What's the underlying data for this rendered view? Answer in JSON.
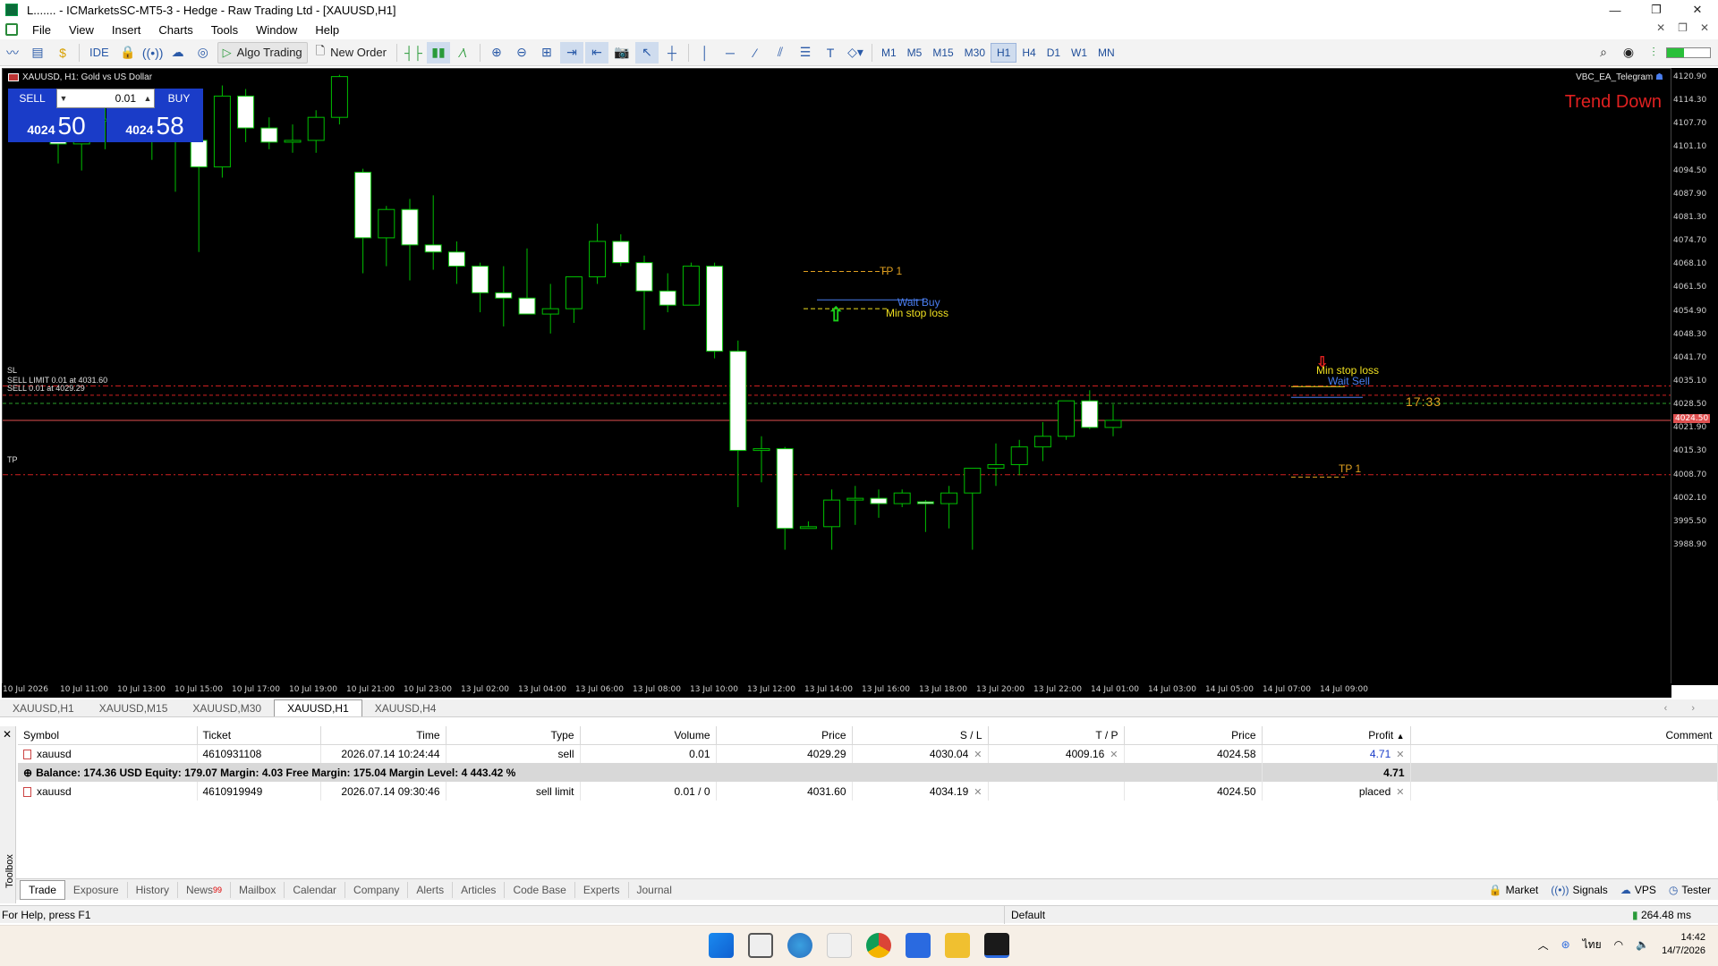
{
  "window": {
    "title": "ICMarketsSC-MT5-3 - Hedge - Raw Trading Ltd - [XAUUSD,H1]",
    "title_prefix": "L.......",
    "controls": [
      "—",
      "❐",
      "✕"
    ]
  },
  "menu": [
    "File",
    "View",
    "Insert",
    "Charts",
    "Tools",
    "Window",
    "Help"
  ],
  "toolbar": {
    "ide_label": "IDE",
    "algo_trading_label": "Algo Trading",
    "new_order_label": "New Order",
    "timeframes": [
      "M1",
      "M5",
      "M15",
      "M30",
      "H1",
      "H4",
      "D1",
      "W1",
      "MN"
    ],
    "active_timeframe": "H1"
  },
  "chart": {
    "symbol_label": "XAUUSD, H1:  Gold vs US Dollar",
    "ea_label": "VBC_EA_Telegram",
    "trend_text": "Trend Down",
    "countdown": "17:33",
    "one_click": {
      "sell_label": "SELL",
      "buy_label": "BUY",
      "lot": "0.01",
      "sell_price_small": "4024",
      "sell_price_big": "50",
      "buy_price_small": "4024",
      "buy_price_big": "58"
    },
    "line_labels": {
      "sl": "SL",
      "sell_limit": "SELL LIMIT 0.01 at 4031.60",
      "sell": "SELL 0.01 at 4029.29",
      "tp": "TP"
    },
    "annotations": {
      "tp1_upper": "TP 1",
      "wait_buy": "Wait Buy",
      "min_sl_upper": "Min stop loss",
      "min_sl_lower": "Min stop loss",
      "wait_sell": "Wait Sell",
      "tp1_lower": "TP 1"
    },
    "price_ticks": [
      "4120.90",
      "4114.30",
      "4107.70",
      "4101.10",
      "4094.50",
      "4087.90",
      "4081.30",
      "4074.70",
      "4068.10",
      "4061.50",
      "4054.90",
      "4048.30",
      "4041.70",
      "4035.10",
      "4028.50",
      "4021.90",
      "4015.30",
      "4008.70",
      "4002.10",
      "3995.50",
      "3988.90"
    ],
    "current_price_tag": "4024.50",
    "time_ticks": [
      "10 Jul 2026",
      "10 Jul 11:00",
      "10 Jul 13:00",
      "10 Jul 15:00",
      "10 Jul 17:00",
      "10 Jul 19:00",
      "10 Jul 21:00",
      "10 Jul 23:00",
      "13 Jul 02:00",
      "13 Jul 04:00",
      "13 Jul 06:00",
      "13 Jul 08:00",
      "13 Jul 10:00",
      "13 Jul 12:00",
      "13 Jul 14:00",
      "13 Jul 16:00",
      "13 Jul 18:00",
      "13 Jul 20:00",
      "13 Jul 22:00",
      "14 Jul 01:00",
      "14 Jul 03:00",
      "14 Jul 05:00",
      "14 Jul 07:00",
      "14 Jul 09:00"
    ],
    "colors": {
      "bg": "#000000",
      "candle": "#ffffff",
      "wick": "#00c000",
      "sl_line": "#d02020",
      "tp_line": "#d02020",
      "bid_line": "#e05050",
      "wait_buy": "#4a7ef0",
      "tp1": "#e0a020",
      "min_sl": "#f0e020",
      "trend": "#e02020",
      "countdown": "#e0a020"
    },
    "candles": [
      {
        "o": 4111.0,
        "h": 4117.0,
        "l": 4097.0,
        "c": 4102.5
      },
      {
        "o": 4102.5,
        "h": 4109.5,
        "l": 4095.0,
        "c": 4109.0
      },
      {
        "o": 4109.0,
        "h": 4114.0,
        "l": 4101.0,
        "c": 4109.5
      },
      {
        "o": 4109.5,
        "h": 4113.0,
        "l": 4104.0,
        "c": 4106.5
      },
      {
        "o": 4106.5,
        "h": 4111.0,
        "l": 4098.0,
        "c": 4104.5
      },
      {
        "o": 4104.5,
        "h": 4109.0,
        "l": 4089.0,
        "c": 4103.5
      },
      {
        "o": 4103.5,
        "h": 4112.0,
        "l": 4072.0,
        "c": 4096.0
      },
      {
        "o": 4096.0,
        "h": 4119.0,
        "l": 4093.0,
        "c": 4116.0
      },
      {
        "o": 4116.0,
        "h": 4118.0,
        "l": 4103.0,
        "c": 4107.0
      },
      {
        "o": 4107.0,
        "h": 4110.0,
        "l": 4101.0,
        "c": 4103.0
      },
      {
        "o": 4103.0,
        "h": 4108.0,
        "l": 4100.0,
        "c": 4103.5
      },
      {
        "o": 4103.5,
        "h": 4112.0,
        "l": 4100.0,
        "c": 4110.0
      },
      {
        "o": 4110.0,
        "h": 4122.0,
        "l": 4108.0,
        "c": 4121.5
      },
      {
        "o": 4094.5,
        "h": 4095.5,
        "l": 4066.0,
        "c": 4076.0
      },
      {
        "o": 4076.0,
        "h": 4085.0,
        "l": 4068.0,
        "c": 4084.0
      },
      {
        "o": 4084.0,
        "h": 4087.0,
        "l": 4064.0,
        "c": 4074.0
      },
      {
        "o": 4074.0,
        "h": 4088.0,
        "l": 4067.0,
        "c": 4072.0
      },
      {
        "o": 4072.0,
        "h": 4075.0,
        "l": 4063.0,
        "c": 4068.0
      },
      {
        "o": 4068.0,
        "h": 4069.0,
        "l": 4055.0,
        "c": 4060.5
      },
      {
        "o": 4060.5,
        "h": 4068.0,
        "l": 4051.0,
        "c": 4059.0
      },
      {
        "o": 4059.0,
        "h": 4073.0,
        "l": 4055.0,
        "c": 4054.5
      },
      {
        "o": 4054.5,
        "h": 4063.0,
        "l": 4049.0,
        "c": 4056.0
      },
      {
        "o": 4056.0,
        "h": 4065.0,
        "l": 4052.0,
        "c": 4065.0
      },
      {
        "o": 4065.0,
        "h": 4080.0,
        "l": 4063.0,
        "c": 4075.0
      },
      {
        "o": 4075.0,
        "h": 4077.0,
        "l": 4068.0,
        "c": 4069.0
      },
      {
        "o": 4069.0,
        "h": 4071.0,
        "l": 4050.0,
        "c": 4061.0
      },
      {
        "o": 4061.0,
        "h": 4066.0,
        "l": 4055.0,
        "c": 4057.0
      },
      {
        "o": 4057.0,
        "h": 4069.0,
        "l": 4057.0,
        "c": 4068.0
      },
      {
        "o": 4068.0,
        "h": 4069.0,
        "l": 4042.0,
        "c": 4044.0
      },
      {
        "o": 4044.0,
        "h": 4047.0,
        "l": 4000.0,
        "c": 4016.0
      },
      {
        "o": 4016.0,
        "h": 4020.0,
        "l": 4007.0,
        "c": 4016.5
      },
      {
        "o": 4016.5,
        "h": 4017.0,
        "l": 3988.0,
        "c": 3994.0
      },
      {
        "o": 3994.0,
        "h": 3996.0,
        "l": 3994.0,
        "c": 3994.5
      },
      {
        "o": 3994.5,
        "h": 4005.0,
        "l": 3988.0,
        "c": 4002.0
      },
      {
        "o": 4002.0,
        "h": 4006.0,
        "l": 3995.0,
        "c": 4002.5
      },
      {
        "o": 4002.5,
        "h": 4005.0,
        "l": 3997.0,
        "c": 4001.0
      },
      {
        "o": 4001.0,
        "h": 4005.0,
        "l": 4000.0,
        "c": 4004.0
      },
      {
        "o": 4001.5,
        "h": 4002.0,
        "l": 3993.0,
        "c": 4001.0
      },
      {
        "o": 4001.0,
        "h": 4006.0,
        "l": 3994.0,
        "c": 4004.0
      },
      {
        "o": 4004.0,
        "h": 4011.0,
        "l": 3988.0,
        "c": 4011.0
      },
      {
        "o": 4011.0,
        "h": 4018.0,
        "l": 4006.0,
        "c": 4012.0
      },
      {
        "o": 4012.0,
        "h": 4019.0,
        "l": 4009.0,
        "c": 4017.0
      },
      {
        "o": 4017.0,
        "h": 4024.0,
        "l": 4013.0,
        "c": 4020.0
      },
      {
        "o": 4020.0,
        "h": 4030.0,
        "l": 4019.0,
        "c": 4030.0
      },
      {
        "o": 4030.0,
        "h": 4033.0,
        "l": 4022.0,
        "c": 4022.5
      },
      {
        "o": 4022.5,
        "h": 4029.0,
        "l": 4020.0,
        "c": 4024.5
      }
    ],
    "levels": {
      "sl": 4034.19,
      "sell_limit": 4031.6,
      "sell": 4029.29,
      "bid": 4024.5,
      "tp": 4009.16
    }
  },
  "chart_tabs": [
    "XAUUSD,H1",
    "XAUUSD,M15",
    "XAUUSD,M30",
    "XAUUSD,H1",
    "XAUUSD,H4"
  ],
  "active_chart_tab": 3,
  "trade": {
    "headers": [
      "Symbol",
      "Ticket",
      "Time",
      "Type",
      "Volume",
      "Price",
      "S / L",
      "T / P",
      "Price",
      "Profit",
      "Comment"
    ],
    "rows": [
      {
        "symbol": "xauusd",
        "ticket": "4610931108",
        "time": "2026.07.14 10:24:44",
        "type": "sell",
        "volume": "0.01",
        "price": "4029.29",
        "sl": "4030.04",
        "tp": "4009.16",
        "price2": "4024.58",
        "profit": "4.71"
      }
    ],
    "balance_line": "Balance: 174.36 USD  Equity: 179.07  Margin: 4.03  Free Margin: 175.04  Margin Level: 4 443.42 %",
    "balance_profit": "4.71",
    "orders": [
      {
        "symbol": "xauusd",
        "ticket": "4610919949",
        "time": "2026.07.14 09:30:46",
        "type": "sell limit",
        "volume": "0.01 / 0",
        "price": "4031.60",
        "sl": "4034.19",
        "tp": "",
        "price2": "4024.50",
        "profit": "placed"
      }
    ]
  },
  "toolbox_label": "Toolbox",
  "bottom_tabs": [
    "Trade",
    "Exposure",
    "History",
    "News",
    "Mailbox",
    "Calendar",
    "Company",
    "Alerts",
    "Articles",
    "Code Base",
    "Experts",
    "Journal"
  ],
  "news_badge": "99",
  "right_tools": [
    "Market",
    "Signals",
    "VPS",
    "Tester"
  ],
  "status": {
    "help": "For Help, press F1",
    "profile": "Default",
    "ping": "264.48 ms"
  },
  "taskbar": {
    "lang": "ไทย",
    "time": "14:42",
    "date": "14/7/2026"
  }
}
